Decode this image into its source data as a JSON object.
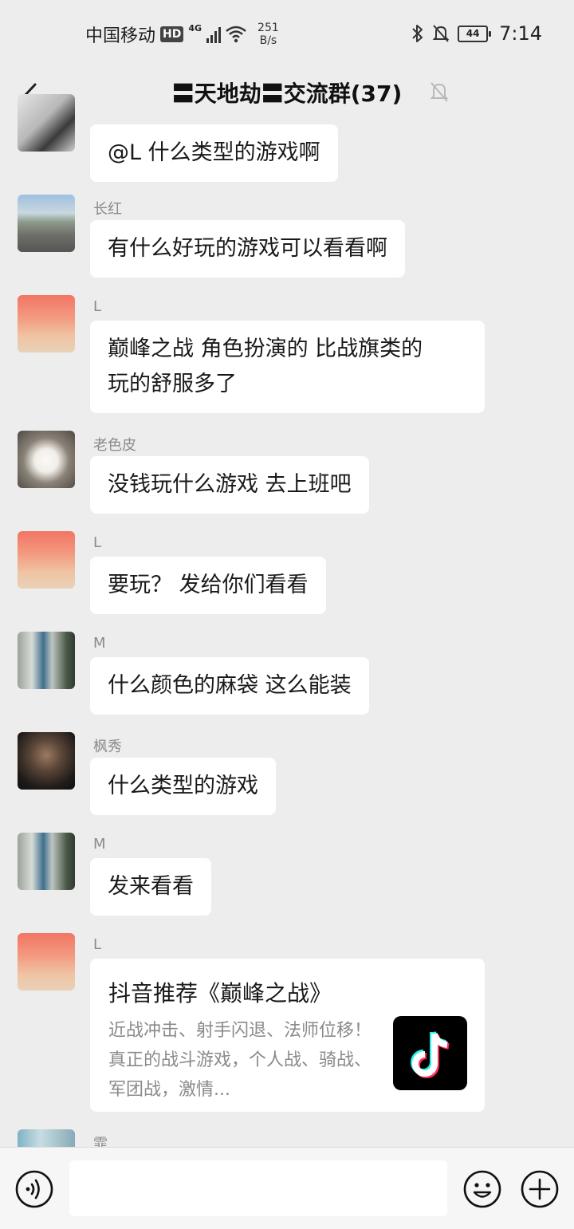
{
  "status_bar": {
    "carrier": "中国移动",
    "hd": "HD",
    "network": "4G",
    "speed_value": "251",
    "speed_unit": "B/s",
    "battery": "44",
    "time": "7:14"
  },
  "header": {
    "title": "〓天地劫〓交流群(37)"
  },
  "messages": [
    {
      "sender": "",
      "text": "@L  什么类型的游戏啊"
    },
    {
      "sender": "长红",
      "text": "有什么好玩的游戏可以看看啊"
    },
    {
      "sender": "L",
      "text_line1": "巅峰之战 角色扮演的 比战旗类的",
      "text_line2": "玩的舒服多了"
    },
    {
      "sender": "老色皮",
      "text": "没钱玩什么游戏 去上班吧"
    },
    {
      "sender": "L",
      "text": "要玩？  发给你们看看"
    },
    {
      "sender": "M",
      "text": "什么颜色的麻袋 这么能装"
    },
    {
      "sender": "枫秀",
      "text": "什么类型的游戏"
    },
    {
      "sender": "M",
      "text": "发来看看"
    },
    {
      "sender": "L",
      "card_title": "抖音推荐《巅峰之战》",
      "card_desc": "近战冲击、射手闪退、法师位移！真正的战斗游戏，个人战、骑战、军团战，激情..."
    },
    {
      "sender": "霏"
    }
  ],
  "input": {
    "placeholder": ""
  },
  "colors": {
    "background": "#ededed",
    "bubble": "#ffffff",
    "sender_name": "#8a8a8a"
  },
  "icons": [
    "back-arrow-icon",
    "mute-bell-icon",
    "voice-icon",
    "emoji-icon",
    "plus-icon",
    "tiktok-logo-icon",
    "bluetooth-icon",
    "wifi-icon",
    "signal-icon"
  ]
}
